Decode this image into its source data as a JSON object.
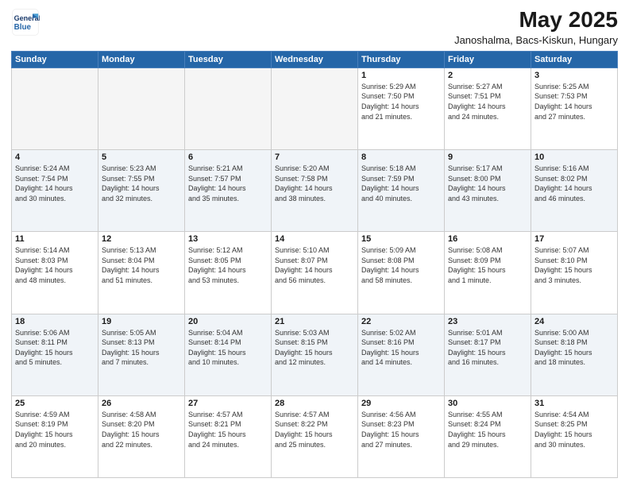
{
  "header": {
    "logo": {
      "line1": "General",
      "line2": "Blue"
    },
    "title": "May 2025",
    "subtitle": "Janoshalma, Bacs-Kiskun, Hungary"
  },
  "weekdays": [
    "Sunday",
    "Monday",
    "Tuesday",
    "Wednesday",
    "Thursday",
    "Friday",
    "Saturday"
  ],
  "weeks": [
    [
      {
        "day": "",
        "info": ""
      },
      {
        "day": "",
        "info": ""
      },
      {
        "day": "",
        "info": ""
      },
      {
        "day": "",
        "info": ""
      },
      {
        "day": "1",
        "info": "Sunrise: 5:29 AM\nSunset: 7:50 PM\nDaylight: 14 hours\nand 21 minutes."
      },
      {
        "day": "2",
        "info": "Sunrise: 5:27 AM\nSunset: 7:51 PM\nDaylight: 14 hours\nand 24 minutes."
      },
      {
        "day": "3",
        "info": "Sunrise: 5:25 AM\nSunset: 7:53 PM\nDaylight: 14 hours\nand 27 minutes."
      }
    ],
    [
      {
        "day": "4",
        "info": "Sunrise: 5:24 AM\nSunset: 7:54 PM\nDaylight: 14 hours\nand 30 minutes."
      },
      {
        "day": "5",
        "info": "Sunrise: 5:23 AM\nSunset: 7:55 PM\nDaylight: 14 hours\nand 32 minutes."
      },
      {
        "day": "6",
        "info": "Sunrise: 5:21 AM\nSunset: 7:57 PM\nDaylight: 14 hours\nand 35 minutes."
      },
      {
        "day": "7",
        "info": "Sunrise: 5:20 AM\nSunset: 7:58 PM\nDaylight: 14 hours\nand 38 minutes."
      },
      {
        "day": "8",
        "info": "Sunrise: 5:18 AM\nSunset: 7:59 PM\nDaylight: 14 hours\nand 40 minutes."
      },
      {
        "day": "9",
        "info": "Sunrise: 5:17 AM\nSunset: 8:00 PM\nDaylight: 14 hours\nand 43 minutes."
      },
      {
        "day": "10",
        "info": "Sunrise: 5:16 AM\nSunset: 8:02 PM\nDaylight: 14 hours\nand 46 minutes."
      }
    ],
    [
      {
        "day": "11",
        "info": "Sunrise: 5:14 AM\nSunset: 8:03 PM\nDaylight: 14 hours\nand 48 minutes."
      },
      {
        "day": "12",
        "info": "Sunrise: 5:13 AM\nSunset: 8:04 PM\nDaylight: 14 hours\nand 51 minutes."
      },
      {
        "day": "13",
        "info": "Sunrise: 5:12 AM\nSunset: 8:05 PM\nDaylight: 14 hours\nand 53 minutes."
      },
      {
        "day": "14",
        "info": "Sunrise: 5:10 AM\nSunset: 8:07 PM\nDaylight: 14 hours\nand 56 minutes."
      },
      {
        "day": "15",
        "info": "Sunrise: 5:09 AM\nSunset: 8:08 PM\nDaylight: 14 hours\nand 58 minutes."
      },
      {
        "day": "16",
        "info": "Sunrise: 5:08 AM\nSunset: 8:09 PM\nDaylight: 15 hours\nand 1 minute."
      },
      {
        "day": "17",
        "info": "Sunrise: 5:07 AM\nSunset: 8:10 PM\nDaylight: 15 hours\nand 3 minutes."
      }
    ],
    [
      {
        "day": "18",
        "info": "Sunrise: 5:06 AM\nSunset: 8:11 PM\nDaylight: 15 hours\nand 5 minutes."
      },
      {
        "day": "19",
        "info": "Sunrise: 5:05 AM\nSunset: 8:13 PM\nDaylight: 15 hours\nand 7 minutes."
      },
      {
        "day": "20",
        "info": "Sunrise: 5:04 AM\nSunset: 8:14 PM\nDaylight: 15 hours\nand 10 minutes."
      },
      {
        "day": "21",
        "info": "Sunrise: 5:03 AM\nSunset: 8:15 PM\nDaylight: 15 hours\nand 12 minutes."
      },
      {
        "day": "22",
        "info": "Sunrise: 5:02 AM\nSunset: 8:16 PM\nDaylight: 15 hours\nand 14 minutes."
      },
      {
        "day": "23",
        "info": "Sunrise: 5:01 AM\nSunset: 8:17 PM\nDaylight: 15 hours\nand 16 minutes."
      },
      {
        "day": "24",
        "info": "Sunrise: 5:00 AM\nSunset: 8:18 PM\nDaylight: 15 hours\nand 18 minutes."
      }
    ],
    [
      {
        "day": "25",
        "info": "Sunrise: 4:59 AM\nSunset: 8:19 PM\nDaylight: 15 hours\nand 20 minutes."
      },
      {
        "day": "26",
        "info": "Sunrise: 4:58 AM\nSunset: 8:20 PM\nDaylight: 15 hours\nand 22 minutes."
      },
      {
        "day": "27",
        "info": "Sunrise: 4:57 AM\nSunset: 8:21 PM\nDaylight: 15 hours\nand 24 minutes."
      },
      {
        "day": "28",
        "info": "Sunrise: 4:57 AM\nSunset: 8:22 PM\nDaylight: 15 hours\nand 25 minutes."
      },
      {
        "day": "29",
        "info": "Sunrise: 4:56 AM\nSunset: 8:23 PM\nDaylight: 15 hours\nand 27 minutes."
      },
      {
        "day": "30",
        "info": "Sunrise: 4:55 AM\nSunset: 8:24 PM\nDaylight: 15 hours\nand 29 minutes."
      },
      {
        "day": "31",
        "info": "Sunrise: 4:54 AM\nSunset: 8:25 PM\nDaylight: 15 hours\nand 30 minutes."
      }
    ]
  ]
}
